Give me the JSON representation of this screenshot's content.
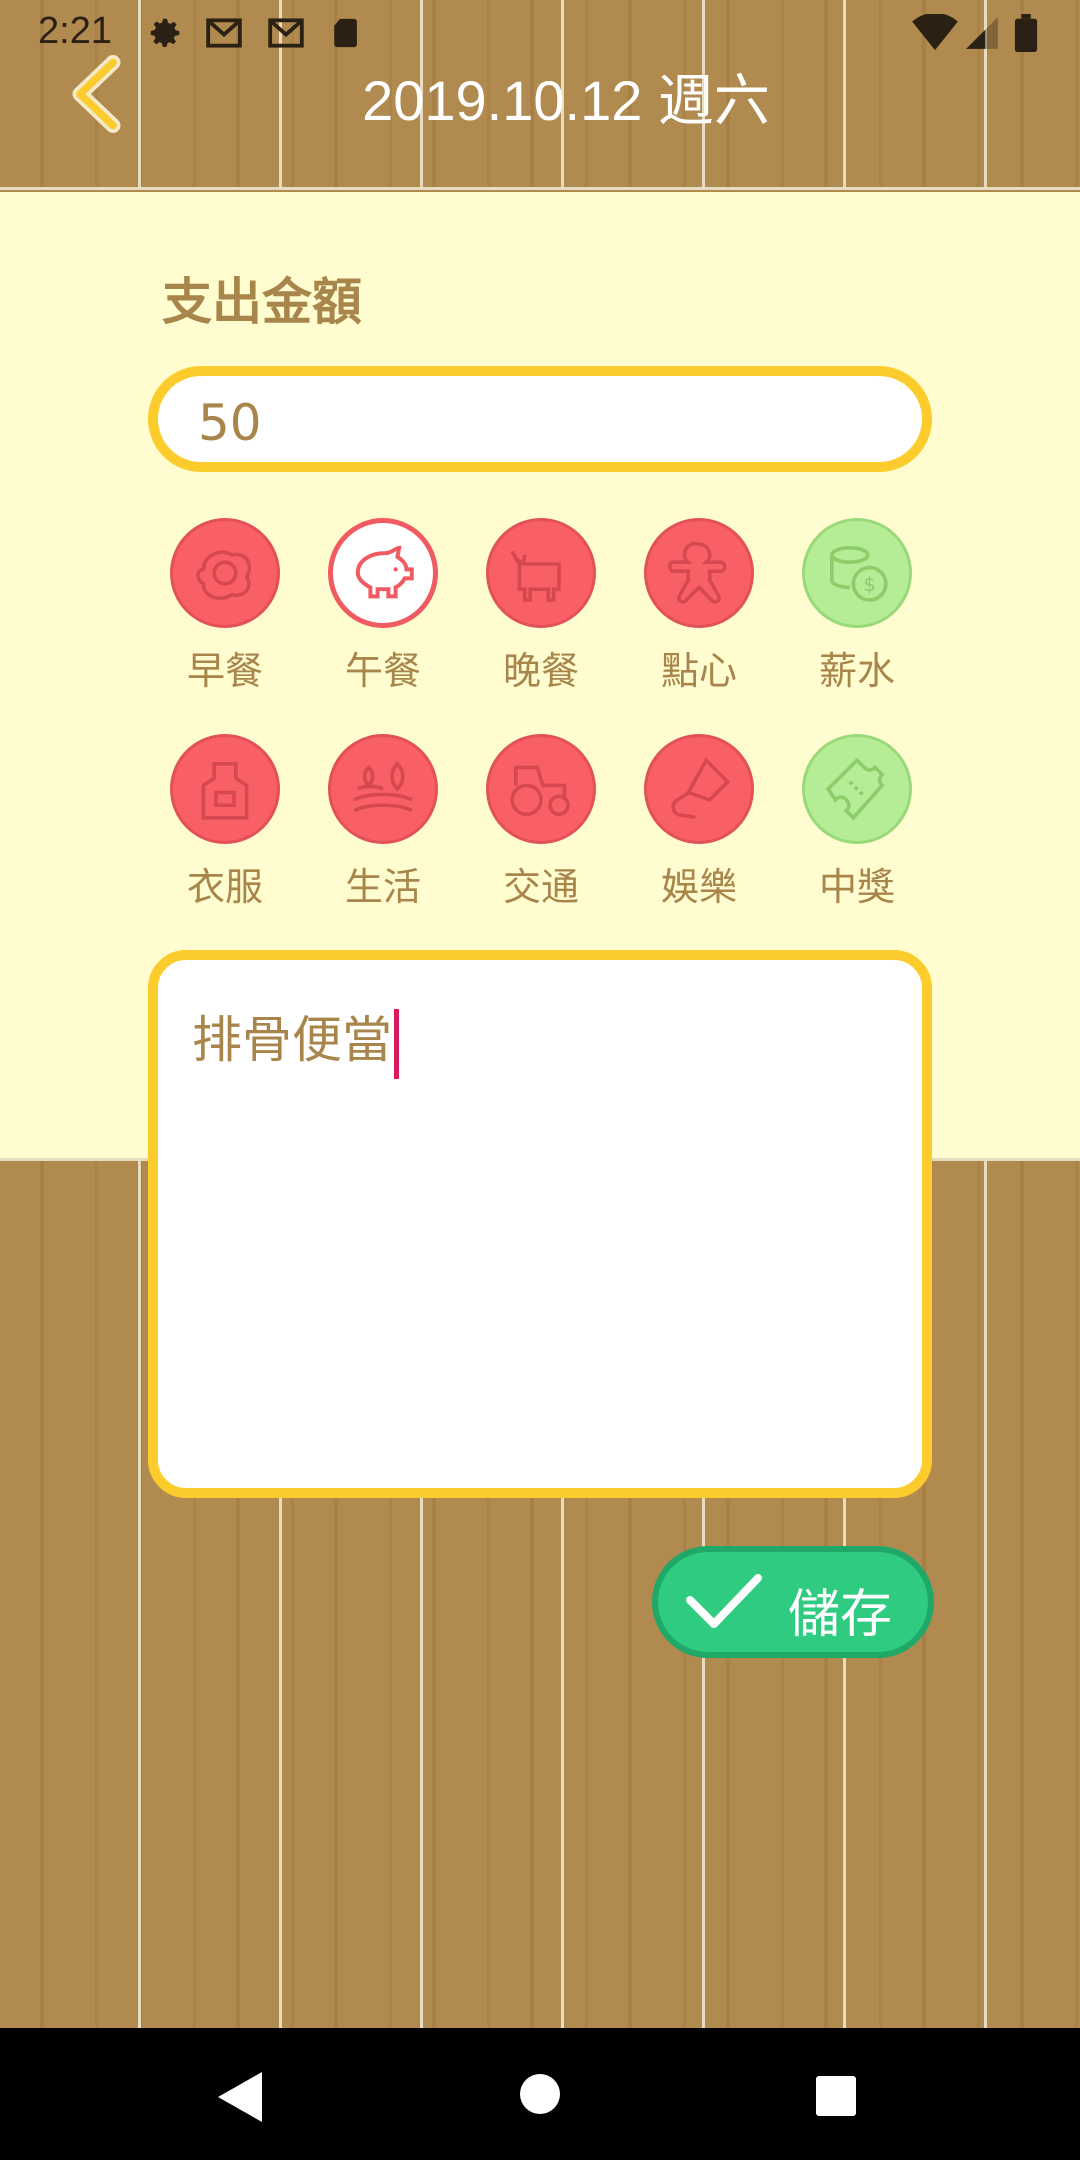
{
  "status_bar": {
    "time": "2:21",
    "icons": [
      "gear-icon",
      "gmail-icon",
      "gmail-icon",
      "sd-card-icon",
      "wifi-icon",
      "signal-icon",
      "battery-icon"
    ]
  },
  "header": {
    "title": "2019.10.12 週六",
    "back_icon": "chevron-left-icon"
  },
  "form": {
    "amount_label": "支出金額",
    "amount_value": "50",
    "categories": [
      {
        "label": "早餐",
        "icon": "fried-egg-icon",
        "kind": "expense"
      },
      {
        "label": "午餐",
        "icon": "pig-icon",
        "kind": "expense",
        "selected": true
      },
      {
        "label": "晚餐",
        "icon": "cow-icon",
        "kind": "expense"
      },
      {
        "label": "點心",
        "icon": "gingerbread-icon",
        "kind": "expense"
      },
      {
        "label": "薪水",
        "icon": "coins-icon",
        "kind": "income"
      },
      {
        "label": "衣服",
        "icon": "apron-icon",
        "kind": "expense"
      },
      {
        "label": "生活",
        "icon": "farm-icon",
        "kind": "expense"
      },
      {
        "label": "交通",
        "icon": "tractor-icon",
        "kind": "expense"
      },
      {
        "label": "娛樂",
        "icon": "kite-icon",
        "kind": "expense"
      },
      {
        "label": "中獎",
        "icon": "ticket-icon",
        "kind": "income"
      }
    ],
    "memo_value": "排骨便當",
    "save_label": "儲存"
  },
  "colors": {
    "expense": "#f96066",
    "income": "#b5ec96",
    "accent": "#fbcc2b",
    "save": "#2fcb81",
    "text": "#a8854a"
  }
}
